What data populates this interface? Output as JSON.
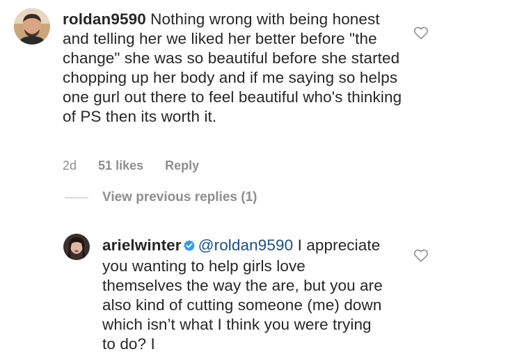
{
  "comments": [
    {
      "username": "roldan9590",
      "text": "Nothing wrong with being honest and telling her we liked her better before \"the change\" she was so beautiful before she started chopping up her body and if me saying so helps one gurl out there to feel beautiful who's thinking of PS then its worth it.",
      "time": "2d",
      "likes": "51 likes",
      "reply_label": "Reply"
    }
  ],
  "view_previous_replies": "View previous replies (1)",
  "reply": {
    "username": "arielwinter",
    "mention": "@roldan9590",
    "text": "I appreciate you wanting to help girls love themselves the way the are, but you are also kind of cutting someone (me) down which isn’t what I think you were trying to do? I"
  },
  "colors": {
    "text": "#262626",
    "secondary": "#8e8e8e",
    "mention": "#1a4f86",
    "verified": "#3897f0"
  },
  "icons": {
    "like": "heart-outline-icon",
    "verified": "verified-badge-icon"
  }
}
